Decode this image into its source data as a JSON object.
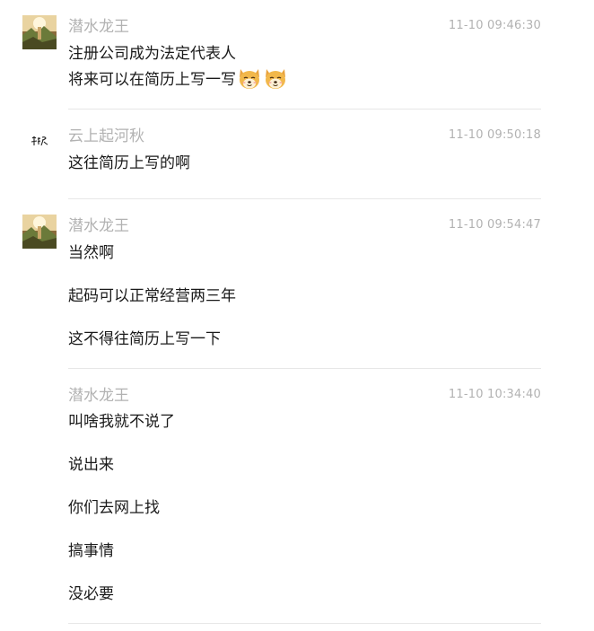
{
  "messages": [
    {
      "sender": "潜水龙王",
      "time": "11-10 09:46:30",
      "avatar_icon": "landscape-avatar-icon",
      "lines": [
        "注册公司成为法定代表人",
        "将来可以在简历上写一写"
      ],
      "emoji_icons": [
        "shiba-doge-emoji-icon",
        "shiba-doge-emoji-icon"
      ]
    },
    {
      "sender": "云上起河秋",
      "time": "11-10 09:50:18",
      "avatar_icon": "calligraphy-avatar-icon",
      "lines": [
        "这往简历上写的啊"
      ]
    },
    {
      "sender": "潜水龙王",
      "time": "11-10 09:54:47",
      "avatar_icon": "landscape-avatar-icon",
      "lines": [
        "当然啊",
        "起码可以正常经营两三年",
        "这不得往简历上写一下"
      ]
    },
    {
      "sender": "潜水龙王",
      "time": "11-10 10:34:40",
      "lines": [
        "叫啥我就不说了",
        "说出来",
        "你们去网上找",
        "搞事情",
        "没必要"
      ]
    }
  ],
  "colors": {
    "sender": "#b2b2b2",
    "time": "#b2b2b2",
    "text": "#1a1a1a",
    "divider": "#e7e7e7"
  }
}
